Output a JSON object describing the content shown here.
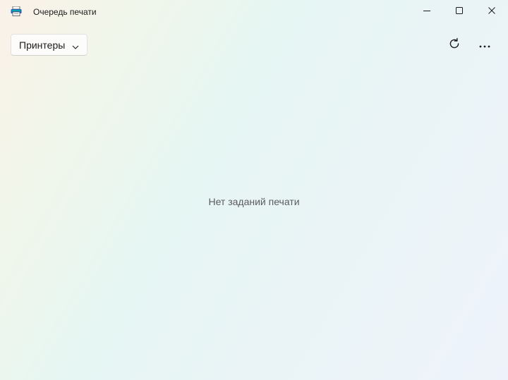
{
  "window": {
    "title": "Очередь печати",
    "app_icon": "printer-icon",
    "controls": {
      "minimize_icon": "minimize-icon",
      "maximize_icon": "maximize-icon",
      "close_icon": "close-icon"
    }
  },
  "toolbar": {
    "printers_label": "Принтеры",
    "printers_icon": "chevron-down-icon",
    "refresh_icon": "refresh-icon",
    "more_icon": "more-icon"
  },
  "main": {
    "empty_message": "Нет заданий печати"
  },
  "colors": {
    "text": "#1b1b1b",
    "muted_text": "#5c5c5c",
    "close_hover": "#c42b1c",
    "icon_teal": "#00a2ad",
    "icon_blue": "#1f5fbf"
  }
}
